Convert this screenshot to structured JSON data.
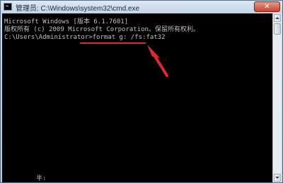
{
  "window": {
    "title": "管理员: C:\\Windows\\system32\\cmd.exe",
    "close_label": "✕",
    "icon": "cmd-icon"
  },
  "console": {
    "lines": [
      "Microsoft Windows [版本 6.1.7601]",
      "版权所有 (c) 2009 Microsoft Corporation。保留所有权利。",
      "",
      "C:\\Users\\Administrator>format g: /fs:fat32"
    ],
    "ime_status": "半:"
  },
  "annotation": {
    "color": "#e02a2a"
  }
}
